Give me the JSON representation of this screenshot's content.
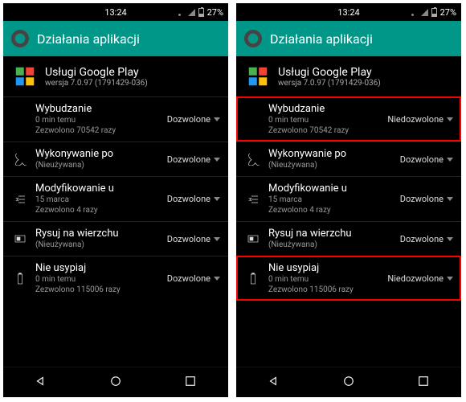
{
  "statusbar": {
    "time": "13:24",
    "battery_pct": "27%"
  },
  "appbar": {
    "title": "Działania aplikacji"
  },
  "app": {
    "name": "Usługi Google Play",
    "version": "wersja 7.0.97 (1791429-036)"
  },
  "left": {
    "rows": [
      {
        "title": "Wybudzanie",
        "sub1": "0 min temu",
        "sub2": "Zezwolono 70542 razy",
        "action": "Dozwolone"
      },
      {
        "title": "Wykonywanie po",
        "sub1": "(Nieużywana)",
        "sub2": "",
        "action": "Dozwolone"
      },
      {
        "title": "Modyfikowanie u",
        "sub1": "15 marca",
        "sub2": "Zezwolono 4 razy",
        "action": "Dozwolone"
      },
      {
        "title": "Rysuj na wierzchu",
        "sub1": "(Nieużywana)",
        "sub2": "",
        "action": "Dozwolone"
      },
      {
        "title": "Nie usypiaj",
        "sub1": "0 min temu",
        "sub2": "Zezwolono 115006 razy",
        "action": "Dozwolone"
      }
    ]
  },
  "right": {
    "rows": [
      {
        "title": "Wybudzanie",
        "sub1": "0 min temu",
        "sub2": "Zezwolono 70542 razy",
        "action": "Niedozwolone",
        "hl": true
      },
      {
        "title": "Wykonywanie po",
        "sub1": "(Nieużywana)",
        "sub2": "",
        "action": "Dozwolone"
      },
      {
        "title": "Modyfikowanie u",
        "sub1": "15 marca",
        "sub2": "Zezwolono 4 razy",
        "action": "Dozwolone"
      },
      {
        "title": "Rysuj na wierzchu",
        "sub1": "(Nieużywana)",
        "sub2": "",
        "action": "Dozwolone"
      },
      {
        "title": "Nie usypiaj",
        "sub1": "0 min temu",
        "sub2": "Zezwolono 115006 razy",
        "action": "Niedozwolone",
        "hl": true
      }
    ]
  }
}
